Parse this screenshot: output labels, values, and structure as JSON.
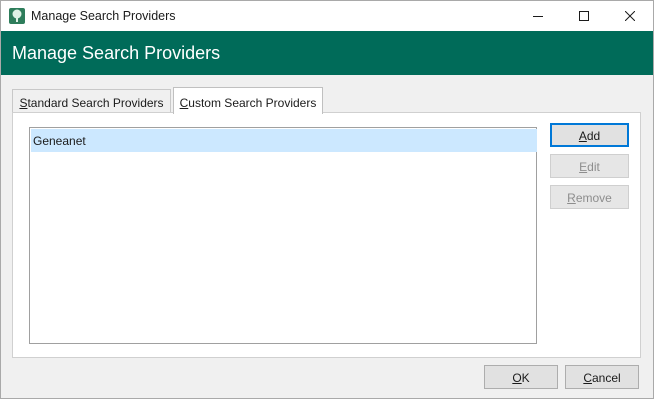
{
  "window": {
    "title": "Manage Search Providers",
    "icon": "tree-icon"
  },
  "header": {
    "title": "Manage Search Providers",
    "color": "#006b59"
  },
  "tabs": [
    {
      "label_first": "S",
      "label_rest": "tandard Search Providers",
      "selected": false
    },
    {
      "label_first": "C",
      "label_rest": "ustom Search Providers",
      "selected": true
    }
  ],
  "providers": {
    "items": [
      "Geneanet"
    ],
    "selected_index": 0
  },
  "buttons": {
    "add_first": "A",
    "add_rest": "dd",
    "edit_first": "E",
    "edit_rest": "dit",
    "remove_first": "R",
    "remove_rest": "emove",
    "ok_first": "O",
    "ok_rest": "K",
    "cancel_first": "C",
    "cancel_rest": "ancel"
  },
  "colors": {
    "accent": "#006b59",
    "selection": "#cce8ff",
    "focus": "#0078d7"
  }
}
